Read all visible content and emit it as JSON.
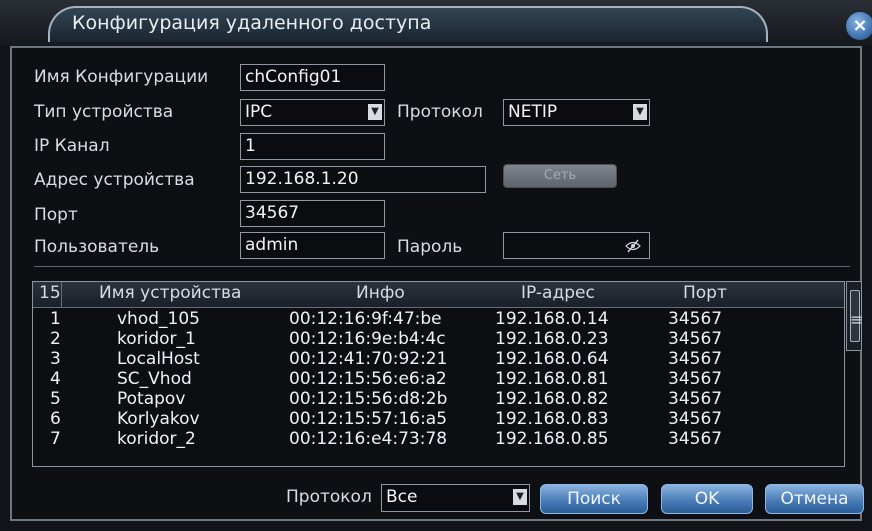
{
  "window": {
    "title": "Конфигурация удаленного доступа",
    "close_glyph": "×"
  },
  "form": {
    "config_name": {
      "label": "Имя Конфигурации",
      "value": "chConfig01"
    },
    "device_type": {
      "label": "Тип устройства",
      "value": "IPC"
    },
    "protocol": {
      "label": "Протокол",
      "value": "NETIP"
    },
    "ip_channel": {
      "label": "IP Канал",
      "value": "1"
    },
    "device_address": {
      "label": "Адрес устройства",
      "value": "192.168.1.20"
    },
    "set_button": {
      "label": "Сеть"
    },
    "port": {
      "label": "Порт",
      "value": "34567"
    },
    "user": {
      "label": "Пользователь",
      "value": "admin"
    },
    "password": {
      "label": "Пароль",
      "value": ""
    },
    "password_icon": "eye-off-icon",
    "dropdown_arrow": "▼"
  },
  "device_list": {
    "count": "15",
    "columns": [
      "Имя устройства",
      "Инфо",
      "IP-адрес",
      "Порт"
    ],
    "rows": [
      {
        "n": "1",
        "name": "vhod_105",
        "info": "00:12:16:9f:47:be",
        "ip": "192.168.0.14",
        "port": "34567"
      },
      {
        "n": "2",
        "name": "koridor_1",
        "info": "00:12:16:9e:b4:4c",
        "ip": "192.168.0.23",
        "port": "34567"
      },
      {
        "n": "3",
        "name": "LocalHost",
        "info": "00:12:41:70:92:21",
        "ip": "192.168.0.64",
        "port": "34567"
      },
      {
        "n": "4",
        "name": "SC_Vhod",
        "info": "00:12:15:56:e6:a2",
        "ip": "192.168.0.81",
        "port": "34567"
      },
      {
        "n": "5",
        "name": "Potapov",
        "info": "00:12:15:56:d8:2b",
        "ip": "192.168.0.82",
        "port": "34567"
      },
      {
        "n": "6",
        "name": "Korlyakov",
        "info": "00:12:15:57:16:a5",
        "ip": "192.168.0.83",
        "port": "34567"
      },
      {
        "n": "7",
        "name": "koridor_2",
        "info": "00:12:16:e4:73:78",
        "ip": "192.168.0.85",
        "port": "34567"
      }
    ],
    "scroll_grip": "≡"
  },
  "footer": {
    "protocol_label": "Протокол",
    "protocol_value": "Все",
    "search_button": "Поиск",
    "ok_button": "OK",
    "cancel_button": "Отмена"
  },
  "colors": {
    "background": "#0d0f12",
    "accent_blue": "#4a7db8",
    "border": "#8e98a4"
  }
}
